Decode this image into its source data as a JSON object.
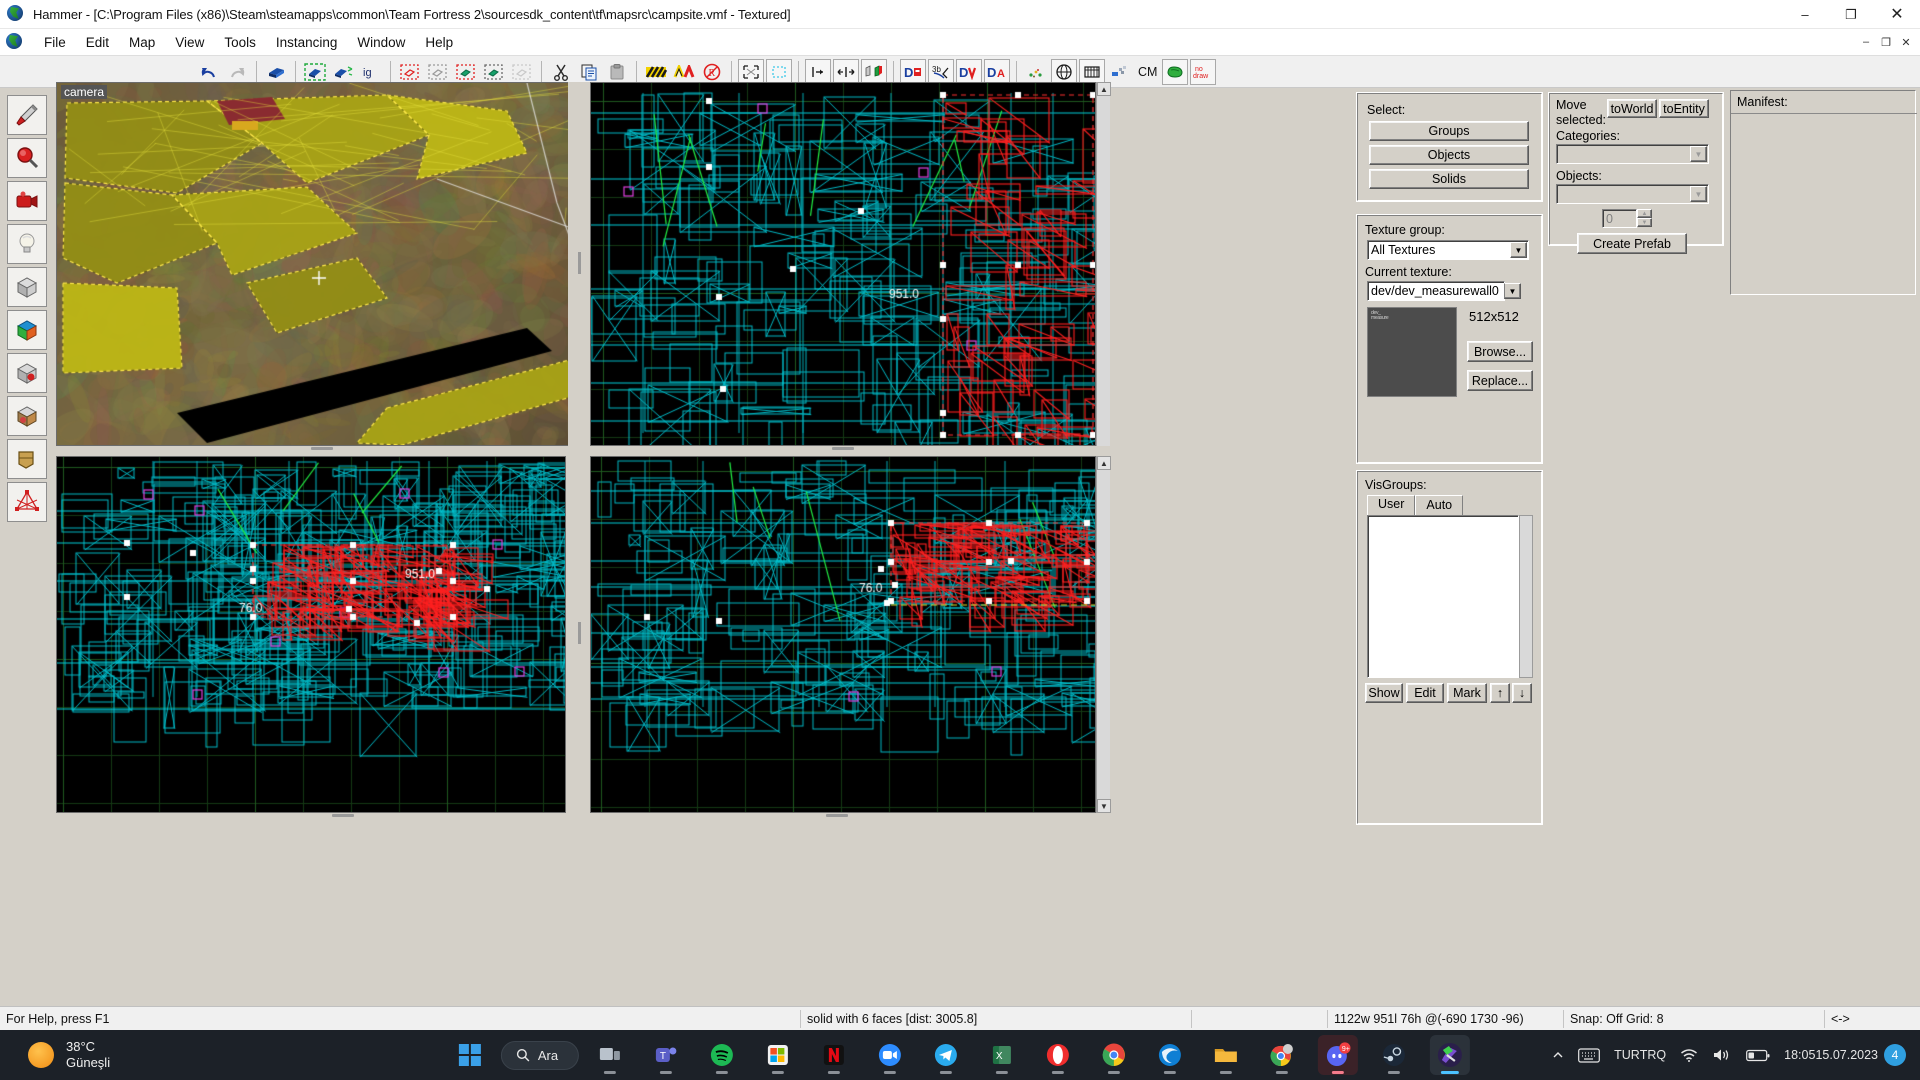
{
  "window": {
    "app_icon": "hammer-icon",
    "title": "Hammer - [C:\\Program Files (x86)\\Steam\\steamapps\\common\\Team Fortress 2\\sourcesdk_content\\tf\\mapsrc\\campsite.vmf - Textured]",
    "controls": {
      "minimize": "–",
      "maximize": "❐",
      "close": "✕"
    },
    "mdi_controls": {
      "minimize": "–",
      "restore": "❐",
      "close": "✕"
    }
  },
  "menubar": {
    "items": [
      {
        "label": "File"
      },
      {
        "label": "Edit"
      },
      {
        "label": "Map"
      },
      {
        "label": "View"
      },
      {
        "label": "Tools"
      },
      {
        "label": "Instancing"
      },
      {
        "label": "Window"
      },
      {
        "label": "Help"
      }
    ]
  },
  "toolbar": {
    "groups": [
      {
        "buttons": [
          {
            "name": "undo-icon",
            "label": "Undo"
          },
          {
            "name": "redo-icon",
            "label": "Redo"
          }
        ]
      },
      {
        "buttons": [
          {
            "name": "carve-icon",
            "label": "Carve"
          }
        ]
      },
      {
        "buttons": [
          {
            "name": "group-icon",
            "label": "Group"
          },
          {
            "name": "ungroup-icon",
            "label": "Ungroup"
          },
          {
            "name": "ignore-groups-icon",
            "label": "Ignore Groups"
          }
        ]
      },
      {
        "buttons": [
          {
            "name": "hide-selected-icon",
            "label": "Hide Selected Objects"
          },
          {
            "name": "hide-unselected-icon",
            "label": "Hide Unselected Objects"
          },
          {
            "name": "show-hidden-icon",
            "label": "Show Hidden Objects"
          },
          {
            "name": "cordon-icon",
            "label": "Cordon Tool"
          },
          {
            "name": "hide-helpers-icon",
            "label": "Hide Helpers"
          }
        ]
      },
      {
        "buttons": [
          {
            "name": "cut-icon",
            "label": "Cut"
          },
          {
            "name": "copy-icon",
            "label": "Copy"
          },
          {
            "name": "paste-icon",
            "label": "Paste"
          }
        ]
      },
      {
        "buttons": [
          {
            "name": "texture-lock-icon",
            "label": "Toggle Texture Lock"
          },
          {
            "name": "texture-scaling-lock-icon",
            "label": "Toggle Texture Scaling Lock"
          },
          {
            "name": "no-entity-icon",
            "label": "Toggle Entity Placement"
          }
        ]
      },
      {
        "buttons": [
          {
            "name": "selection-bounds-icon",
            "label": "Show Selection Bounds"
          },
          {
            "name": "cordon-bounds-icon",
            "label": "Show Cordon Bounds"
          }
        ]
      },
      {
        "buttons": [
          {
            "name": "vertex-tool-icon",
            "label": "Vertex Tool"
          },
          {
            "name": "clipping-tool-icon",
            "label": "Clipping Tool"
          },
          {
            "name": "paint-texture-icon",
            "label": "Apply Current Texture"
          }
        ]
      },
      {
        "buttons": [
          {
            "name": "entity-report-icon",
            "label": "Entity Report"
          },
          {
            "name": "check-map-icon",
            "label": "Check for Problems"
          },
          {
            "name": "vis-groups-icon",
            "label": "VisGroups"
          },
          {
            "name": "autovis-icon",
            "label": "Auto VisGroups"
          }
        ]
      },
      {
        "buttons": [
          {
            "name": "sprinkle-icon",
            "label": "Sprinkle Tool"
          },
          {
            "name": "radius-culling-icon",
            "label": "Radius Culling"
          },
          {
            "name": "3d-grid-icon",
            "label": "3D Grid"
          },
          {
            "name": "displacement-icon",
            "label": "Displacement"
          }
        ]
      },
      {
        "label": "CM"
      },
      {
        "buttons": [
          {
            "name": "run-map-icon",
            "label": "Run Map"
          },
          {
            "name": "no-draw-icon",
            "label": "No Draw"
          }
        ]
      }
    ],
    "cm_label": "CM",
    "nodraw_label": "no\ndraw"
  },
  "tool_palette": {
    "items": [
      {
        "name": "selection-tool",
        "label": "Selection Tool"
      },
      {
        "name": "magnify-tool",
        "label": "Magnify"
      },
      {
        "name": "camera-tool",
        "label": "Camera"
      },
      {
        "name": "entity-tool",
        "label": "Entity Tool"
      },
      {
        "name": "block-tool",
        "label": "Block Tool"
      },
      {
        "name": "texture-tool",
        "label": "Toggle Texture Application"
      },
      {
        "name": "apply-decals-tool",
        "label": "Apply Decals"
      },
      {
        "name": "apply-overlays-tool",
        "label": "Apply Overlays"
      },
      {
        "name": "clipping-tool",
        "label": "Clipping Tool"
      },
      {
        "name": "vertex-tool",
        "label": "Vertex Tool"
      },
      {
        "name": "path-tool",
        "label": "Path Tool"
      }
    ]
  },
  "viewports": [
    {
      "id": "camera",
      "label": "camera",
      "type": "3d-textured"
    },
    {
      "id": "front",
      "label": "",
      "type": "2d-wireframe"
    },
    {
      "id": "top",
      "label": "",
      "type": "2d-wireframe"
    },
    {
      "id": "side",
      "label": "",
      "type": "2d-wireframe"
    }
  ],
  "viewport_measurements": [
    {
      "viewport": "front",
      "value": "951.0"
    },
    {
      "viewport": "top",
      "value": "951.0"
    },
    {
      "viewport": "top",
      "value": "76.0"
    },
    {
      "viewport": "side",
      "value": "76.0"
    }
  ],
  "right_panel": {
    "select_group": {
      "title": "",
      "label": "Select:",
      "buttons": [
        {
          "label": "Groups",
          "name": "select-groups-button"
        },
        {
          "label": "Objects",
          "name": "select-objects-button"
        },
        {
          "label": "Solids",
          "name": "select-solids-button"
        }
      ]
    },
    "texture_group": {
      "group_label": "Texture group:",
      "group_value": "All Textures",
      "current_label": "Current texture:",
      "current_value": "dev/dev_measurewall0",
      "size": "512x512",
      "browse_label": "Browse...",
      "replace_label": "Replace...",
      "swatch_text": "dev_\nmeasure"
    },
    "visgroups": {
      "title": "VisGroups:",
      "tabs": [
        {
          "label": "User",
          "active": true
        },
        {
          "label": "Auto",
          "active": false
        }
      ],
      "items": [],
      "buttons": [
        {
          "label": "Show",
          "name": "visgroup-show-button"
        },
        {
          "label": "Edit",
          "name": "visgroup-edit-button"
        },
        {
          "label": "Mark",
          "name": "visgroup-mark-button"
        }
      ],
      "move_up": "↑",
      "move_down": "↓"
    },
    "prefabs": {
      "move_label_line1": "Move",
      "move_label_line2": "selected:",
      "to_world_label": "toWorld",
      "to_entity_label": "toEntity",
      "categories_label": "Categories:",
      "categories_value": "",
      "objects_label": "Objects:",
      "objects_value": "",
      "spin_value": "0",
      "create_prefab_label": "Create Prefab"
    },
    "manifest": {
      "title": "Manifest:",
      "items": []
    }
  },
  "statusbar": {
    "help": "For Help, press F1",
    "selection": "solid with 6 faces   [dist: 3005.8]",
    "empty": "",
    "dimensions": "1122w 951l 76h @(-690 1730 -96)",
    "snap": "Snap: Off Grid: 8",
    "zoom": "<->"
  },
  "taskbar": {
    "weather": {
      "temperature": "38°C",
      "condition": "Güneşli"
    },
    "start_label": "start-button",
    "search": {
      "label": "Ara",
      "icon": "search-icon"
    },
    "apps": [
      {
        "name": "task-view",
        "label": "Task View",
        "active": false
      },
      {
        "name": "teams",
        "label": "Microsoft Teams",
        "active": false
      },
      {
        "name": "spotify",
        "label": "Spotify",
        "active": false
      },
      {
        "name": "microsoft-store",
        "label": "Microsoft Store",
        "active": false
      },
      {
        "name": "netflix",
        "label": "Netflix",
        "active": false
      },
      {
        "name": "zoom",
        "label": "Zoom",
        "active": false
      },
      {
        "name": "telegram",
        "label": "Telegram",
        "active": false
      },
      {
        "name": "excel",
        "label": "Excel",
        "active": false
      },
      {
        "name": "opera",
        "label": "Opera",
        "active": false
      },
      {
        "name": "chrome",
        "label": "Google Chrome",
        "active": false
      },
      {
        "name": "edge",
        "label": "Microsoft Edge",
        "active": false
      },
      {
        "name": "file-explorer",
        "label": "File Explorer",
        "active": false
      },
      {
        "name": "chrome-window",
        "label": "Chrome",
        "active": false
      },
      {
        "name": "discord",
        "label": "Discord",
        "active": false,
        "badge": "9+"
      },
      {
        "name": "steam",
        "label": "Steam",
        "active": false
      },
      {
        "name": "hammer",
        "label": "Hammer Editor",
        "active": true
      }
    ],
    "tray": {
      "chevron": "∧",
      "keyboard_icon": "keyboard-icon",
      "language": {
        "line1": "TUR",
        "line2": "TRQ"
      },
      "wifi_icon": "wifi-icon",
      "volume_icon": "volume-icon",
      "battery_icon": "battery-icon",
      "clock": {
        "time": "18:05",
        "date": "15.07.2023"
      },
      "notification_count": "4"
    }
  },
  "colors": {
    "window_bg": "#d4d0c8",
    "viewport_bg": "#000000",
    "grid": "#1d3a1d",
    "selection_red": "#ff0000",
    "wire_cyan": "#00c8c8",
    "wire_green": "#00ff00",
    "taskbar_bg": "#1c2128",
    "accent_blue": "#3aa0e8"
  }
}
